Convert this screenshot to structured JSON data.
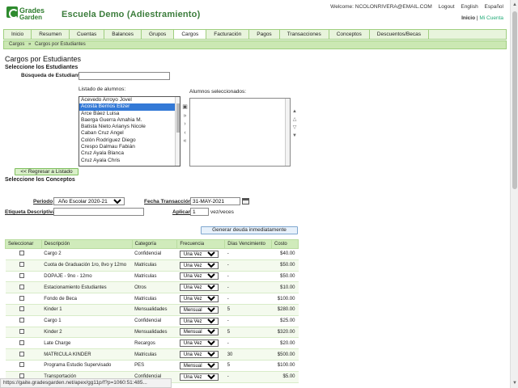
{
  "brand": {
    "line1": "Grades",
    "line2": "Garden",
    "school": "Escuela Demo (Adiestramiento)"
  },
  "toplinks": {
    "welcome": "Welcome: NCOLONRIVERA@EMAIL.COM",
    "logout": "Logout",
    "english": "English",
    "espanol": "Español"
  },
  "sublinks": {
    "inicio": "Inicio",
    "sep": "|",
    "cuenta": "Mi Cuenta"
  },
  "nav": [
    "Inicio",
    "Resumen",
    "Cuentas",
    "Balances",
    "Grupos",
    "Cargos",
    "Facturación",
    "Pagos",
    "Transacciones",
    "Conceptos",
    "Descuentos/Becas"
  ],
  "breadcrumb": {
    "a": "Cargos",
    "sep": "»",
    "b": "Cargos por Estudiantes"
  },
  "page": {
    "title": "Cargos por Estudiantes",
    "sec_students": "Seleccione los Estudiantes",
    "search_label": "Búsqueda de Estudiante",
    "list_label": "Listado de alumnos:",
    "selected_label": "Alumnos seleccionados:",
    "back_button": "<< Regresar a Listado",
    "sec_concepts": "Seleccione los Conceptos",
    "periodo_label": "Periodo",
    "periodo_value": "Año Escolar 2020-21",
    "fecha_label": "Fecha Transacción",
    "fecha_value": "31-MAY-2021",
    "etiqueta_label": "Etiqueta Descriptiva",
    "aplicar_label": "Aplicar",
    "aplicar_value": "1",
    "veces": "vez/veces",
    "generate_button": "Generar deuda inmediatamente"
  },
  "students": [
    "Acevedo Arroyo Jovel",
    "Acosta Berrios Elizer",
    "Arce Báez Luisa",
    "Baerga Guerra Amahia M.",
    "Batista Nieto Arianys Nicole",
    "Caban Cruz Angel",
    "Colón Rodríguez Diego",
    "Crespo Dalmau Fabián",
    "Cruz Ayala Blanca",
    "Cruz Ayala Chris"
  ],
  "selected_student_index": 1,
  "table": {
    "headers": [
      "Seleccionar",
      "Descripción",
      "Categoría",
      "Frecuencia",
      "Días Vencimiento",
      "Costo"
    ],
    "rows": [
      [
        "Cargo 2",
        "Confidencial",
        "Una Vez",
        "-",
        "$40.00"
      ],
      [
        "Cuota de Graduación 1ro, 8vo y 12mo",
        "Matriculas",
        "Una Vez",
        "-",
        "$50.00"
      ],
      [
        "DOPAJE - 9no - 12mo",
        "Matriculas",
        "Una Vez",
        "-",
        "$50.00"
      ],
      [
        "Estacionamiento Estudiantes",
        "Otros",
        "Una Vez",
        "-",
        "$10.00"
      ],
      [
        "Fondo de Beca",
        "Matriculas",
        "Una Vez",
        "-",
        "$100.00"
      ],
      [
        "Kinder 1",
        "Mensualidades",
        "Mensual",
        "5",
        "$280.00"
      ],
      [
        "Cargo 1",
        "Confidencial",
        "Una Vez",
        "-",
        "$25.00"
      ],
      [
        "Kinder 2",
        "Mensualidades",
        "Mensual",
        "5",
        "$320.00"
      ],
      [
        "Late Charge",
        "Recargos",
        "Una Vez",
        "-",
        "$20.00"
      ],
      [
        "MATRICULA KINDER",
        "Matriculas",
        "Una Vez",
        "30",
        "$500.00"
      ],
      [
        "Programa Estudio Supervisado",
        "PES",
        "Mensual",
        "5",
        "$100.00"
      ],
      [
        "Transportación",
        "Confidencial",
        "Una Vez",
        "-",
        "$5.00"
      ]
    ]
  },
  "status_url": "https://gaite.gradesgarden.net/apex/gg11p/f?p=1060:51:485..."
}
